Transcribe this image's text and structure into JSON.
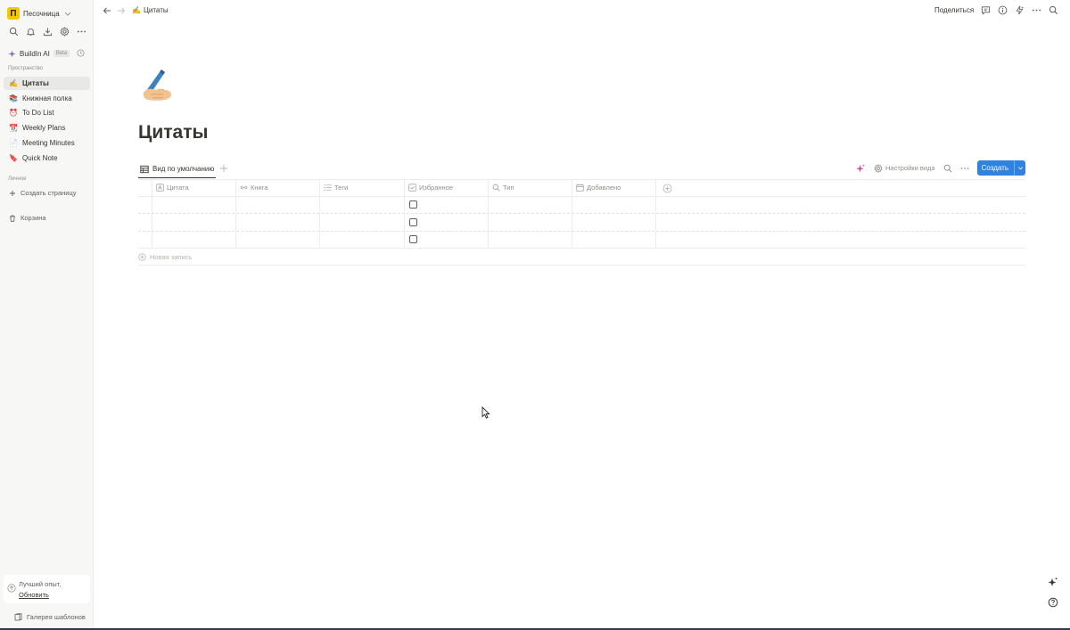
{
  "workspace": {
    "logo_letter": "П",
    "name": "Песочница"
  },
  "sidebar": {
    "ai": {
      "name": "BuildIn AI",
      "badge": "Beta"
    },
    "space_label": "Пространство",
    "items": [
      {
        "emoji": "✍️",
        "label": "Цитаты",
        "active": true
      },
      {
        "emoji": "📚",
        "label": "Книжная полка"
      },
      {
        "emoji": "⏰",
        "label": "To Do List"
      },
      {
        "emoji": "📆",
        "label": "Weekly Plans"
      },
      {
        "emoji": "📄",
        "label": "Meeting Minutes"
      },
      {
        "emoji": "🔖",
        "label": "Quick Note"
      }
    ],
    "personal_label": "Личное",
    "create_page": "Создать страницу",
    "trash": "Корзина",
    "promo": {
      "line1": "Лучший опыт,",
      "link": "Обновить"
    },
    "gallery": "Галерея шаблонов"
  },
  "topbar": {
    "breadcrumb": {
      "emoji": "✍️",
      "label": "Цитаты"
    },
    "share": "Поделиться"
  },
  "page": {
    "icon": "writing-hand",
    "title": "Цитаты"
  },
  "view_bar": {
    "tab_label": "Вид по умолчанию",
    "settings_label": "Настройки вида",
    "create_label": "Создать"
  },
  "table": {
    "columns": [
      {
        "icon": "text-icon",
        "label": "Цитата"
      },
      {
        "icon": "link-icon",
        "label": "Книга"
      },
      {
        "icon": "list-icon",
        "label": "Теги"
      },
      {
        "icon": "checkbox-icon",
        "label": "Избранное"
      },
      {
        "icon": "search-icon",
        "label": "Тип"
      },
      {
        "icon": "calendar-icon",
        "label": "Добавлено"
      }
    ],
    "rows": [
      {
        "favorite": false
      },
      {
        "favorite": false
      },
      {
        "favorite": false
      }
    ],
    "new_record": "Новая запись"
  },
  "colors": {
    "accent": "#2f83df",
    "sidebar_bg": "#f7f7f5",
    "workspace_logo": "#f7c600"
  }
}
